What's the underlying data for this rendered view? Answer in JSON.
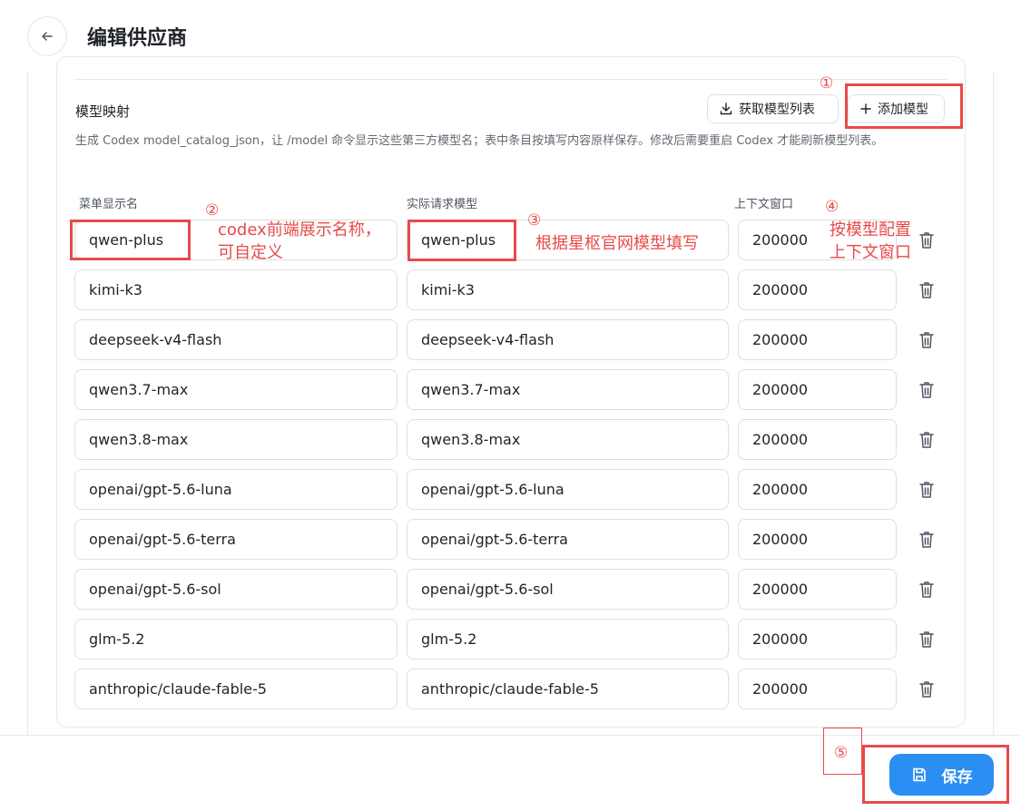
{
  "header": {
    "title": "编辑供应商"
  },
  "section": {
    "title": "模型映射",
    "description": "生成 Codex model_catalog_json，让 /model 命令显示这些第三方模型名；表中条目按填写内容原样保存。修改后需要重启 Codex 才能刷新模型列表。",
    "fetch_label": "获取模型列表",
    "add_label": "添加模型"
  },
  "columns": {
    "name": "菜单显示名",
    "model": "实际请求模型",
    "context": "上下文窗口"
  },
  "rows": [
    {
      "name": "qwen-plus",
      "model": "qwen-plus",
      "context": "200000"
    },
    {
      "name": "kimi-k3",
      "model": "kimi-k3",
      "context": "200000"
    },
    {
      "name": "deepseek-v4-flash",
      "model": "deepseek-v4-flash",
      "context": "200000"
    },
    {
      "name": "qwen3.7-max",
      "model": "qwen3.7-max",
      "context": "200000"
    },
    {
      "name": "qwen3.8-max",
      "model": "qwen3.8-max",
      "context": "200000"
    },
    {
      "name": "openai/gpt-5.6-luna",
      "model": "openai/gpt-5.6-luna",
      "context": "200000"
    },
    {
      "name": "openai/gpt-5.6-terra",
      "model": "openai/gpt-5.6-terra",
      "context": "200000"
    },
    {
      "name": "openai/gpt-5.6-sol",
      "model": "openai/gpt-5.6-sol",
      "context": "200000"
    },
    {
      "name": "glm-5.2",
      "model": "glm-5.2",
      "context": "200000"
    },
    {
      "name": "anthropic/claude-fable-5",
      "model": "anthropic/claude-fable-5",
      "context": "200000"
    }
  ],
  "footer": {
    "save_label": "保存"
  },
  "annotations": {
    "n1": "①",
    "n2": "②",
    "n3": "③",
    "n4": "④",
    "n5": "⑤",
    "name_note_1": "codex前端展示名称，",
    "name_note_2": "可自定义",
    "model_note": "根据星枢官网模型填写",
    "ctx_note_1": "按模型配置",
    "ctx_note_2": "上下文窗口"
  },
  "colors": {
    "accent": "#2b8ef3",
    "annotation": "#e84a4a"
  },
  "icons": {
    "back": "arrow-left-icon",
    "download": "download-icon",
    "plus": "plus-icon",
    "trash": "trash-icon",
    "save": "save-icon"
  }
}
